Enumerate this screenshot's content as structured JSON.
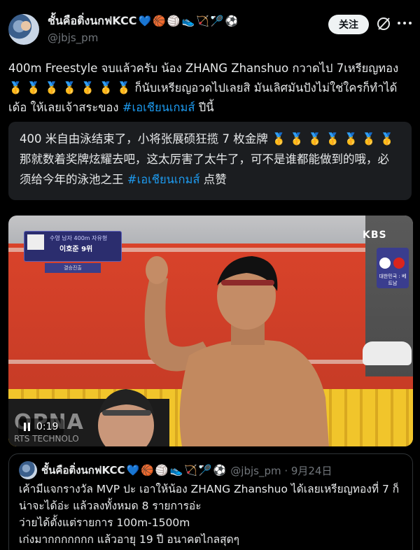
{
  "author": {
    "display_name": "ชั้นคือติ่งนกฟKCC",
    "emojis": [
      "💙",
      "🏀",
      "🏐",
      "👟",
      "🏹",
      "🏸",
      "⚽"
    ],
    "handle": "@jbjs_pm"
  },
  "actions": {
    "follow_label": "关注"
  },
  "post": {
    "text_before_tag": "400m Freestyle จบแล้วครับ น้อง ZHANG Zhanshuo กวาดไป 7เหรียญทอง 🥇 🥇 🥇 🥇 🥇 🥇 🥇 ก็นับเหรียญอวดไปเลยสิ มันเลิศมันปังไม่ใช่ใครก็ทำได้เด้อ ให้เลยเจ้าสระของ ",
    "hashtag": "#เอเชียนเกมส์",
    "text_after_tag": " ปีนี้"
  },
  "translation": {
    "text_before_tag": "400 米自由泳结束了，小将张展硕狂揽 7 枚金牌 🥇 🥇 🥇 🥇 🥇 🥇 🥇 那就数着奖牌炫耀去吧，这太厉害了太牛了，可不是谁都能做到的哦，必须给今年的泳池之王 ",
    "hashtag": "#เอเชียนเกมส์",
    "text_after_tag": " 点赞"
  },
  "video": {
    "timecode": "0:19",
    "broadcaster": "KBS",
    "sponsor_text": "OPNA",
    "sponsor_sub": "RTS TECHNOLO",
    "graphic_line1": "수영 남자 400m 자유형",
    "graphic_line2": "이호준 9위",
    "graphic_line3": "결승진출",
    "score_line": "대한민국 : 베트남"
  },
  "quoted_post": {
    "display_name": "ชั้นคือติ่งนกฟKCC",
    "emojis": [
      "💙",
      "🏀",
      "🏐",
      "👟",
      "🏹",
      "🏸",
      "⚽"
    ],
    "handle_date": "@jbjs_pm · 9月24日",
    "lines": [
      "เค้ามีแจกรางวัล MVP ปะ เอาให้น้อง ZHANG Zhanshuo ได้เลยเหรียญทองที่ 7 ก็น่าจะได้อ่ะ แล้วลงทั้งหมด 8 รายการอ่ะ",
      "ว่ายได้ตั้งแต่รายการ 100m-1500m",
      "เก่งมากกกกกกก แล้วอายุ 19 ปี อนาคตไกลสุดๆ"
    ]
  },
  "colors": {
    "background": "#000000",
    "text": "#e7e9ea",
    "muted": "#71767b",
    "link": "#1d9bf0",
    "translation_bg": "#1b1d20"
  }
}
